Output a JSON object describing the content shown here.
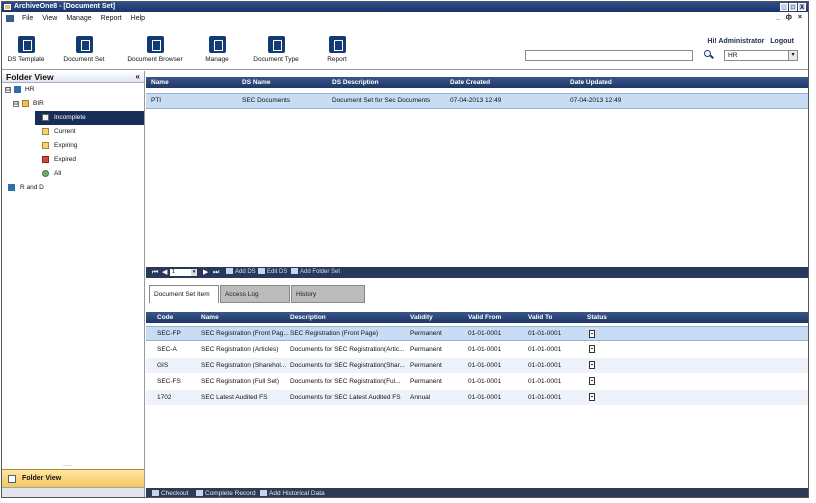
{
  "window": {
    "title": "ArchiveOne8 - [Document Set]",
    "controls": [
      "_",
      "□",
      "X"
    ],
    "mdi_controls": [
      "_",
      "ф",
      "×"
    ]
  },
  "menu": {
    "items": [
      "File",
      "View",
      "Manage",
      "Report",
      "Help"
    ]
  },
  "toolbar": {
    "buttons": [
      {
        "label": "DS Template",
        "icon": "ds-template-icon"
      },
      {
        "label": "Document Set",
        "icon": "document-set-icon"
      },
      {
        "label": "Document Browser",
        "icon": "document-browser-icon"
      },
      {
        "label": "Manage",
        "icon": "manage-icon"
      },
      {
        "label": "Document Type",
        "icon": "document-type-icon"
      },
      {
        "label": "Report",
        "icon": "report-icon"
      }
    ],
    "greeting": "Hi! Administrator",
    "logout_label": "Logout",
    "search_value": "",
    "department_value": "HR"
  },
  "folder_view": {
    "title": "Folder View",
    "collapse_glyph": "«",
    "tree": [
      {
        "label": "HR",
        "toggle": "⊟",
        "icon": "house"
      },
      {
        "label": "BIR",
        "toggle": "⊟",
        "icon": "folder"
      },
      {
        "label": "Incomplete",
        "icon": "doc-white",
        "selected": true
      },
      {
        "label": "Current",
        "icon": "doc-yellow"
      },
      {
        "label": "Expiring",
        "icon": "doc-yellow"
      },
      {
        "label": "Expired",
        "icon": "doc-red"
      },
      {
        "label": "All",
        "icon": "globe"
      },
      {
        "label": "R and D",
        "icon": "house"
      }
    ],
    "footer_dots": "......",
    "footer_label": "Folder View"
  },
  "document_sets": {
    "columns": [
      "Name",
      "DS Name",
      "DS Description",
      "Date Created",
      "Date Updated"
    ],
    "rows": [
      {
        "name": "PTI",
        "ds_name": "SEC Documents",
        "ds_description": "Document Set for Sec Documents",
        "date_created": "07-04-2013 12:49",
        "date_updated": "07-04-2013 12:49"
      }
    ]
  },
  "pager": {
    "page": "1",
    "add_ds": "Add DS",
    "edit_ds": "Edit DS",
    "add_folder_set": "Add Folder Set"
  },
  "tabs": [
    "Document Set Item",
    "Access Log",
    "History"
  ],
  "items": {
    "columns": [
      "Code",
      "Name",
      "Description",
      "Validity",
      "Valid From",
      "Valid To",
      "Status"
    ],
    "rows": [
      {
        "code": "SEC-FP",
        "name": "SEC Registration (Front Pag...",
        "description": "SEC Registration (Front Page)",
        "validity": "Permanent",
        "valid_from": "01-01-0001",
        "valid_to": "01-01-0001"
      },
      {
        "code": "SEC-A",
        "name": "SEC Registration (Articles)",
        "description": "Documents for SEC Registration(Artic...",
        "validity": "Permanent",
        "valid_from": "01-01-0001",
        "valid_to": "01-01-0001"
      },
      {
        "code": "GIS",
        "name": "SEC Registration (Sharehol...",
        "description": "Documents for SEC Registration(Shar...",
        "validity": "Permanent",
        "valid_from": "01-01-0001",
        "valid_to": "01-01-0001"
      },
      {
        "code": "SEC-FS",
        "name": "SEC Registration (Full Set)",
        "description": "Documents for SEC Registration(Ful...",
        "validity": "Permanent",
        "valid_from": "01-01-0001",
        "valid_to": "01-01-0001"
      },
      {
        "code": "1702",
        "name": "SEC Latest Audited FS",
        "description": "Documents for SEC Latest Audited FS",
        "validity": "Annual",
        "valid_from": "01-01-0001",
        "valid_to": "01-01-0001"
      }
    ]
  },
  "bottom_actions": [
    "Checkout",
    "Complete Record",
    "Add Historical Data"
  ]
}
